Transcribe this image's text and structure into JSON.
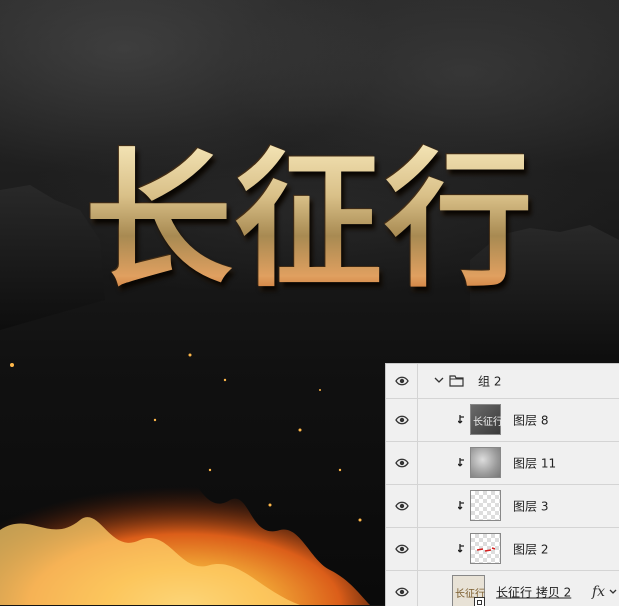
{
  "artwork": {
    "title_text": "长征行"
  },
  "layers_panel": {
    "group": {
      "name": "组 2"
    },
    "layers": [
      {
        "name": "图层 8",
        "thumb": "dark",
        "thumb_art": "长征行"
      },
      {
        "name": "图层 11",
        "thumb": "cloud"
      },
      {
        "name": "图层 3",
        "thumb": "transparent"
      },
      {
        "name": "图层 2",
        "thumb": "red-marks"
      },
      {
        "name": "长征行 拷贝 2",
        "thumb": "smart-object",
        "thumb_art": "长征行",
        "fx_label": "fx"
      }
    ]
  },
  "colors": {
    "gold": "#d8c28c",
    "fire": "#f08a20",
    "panel_bg": "#f0f0f0"
  }
}
